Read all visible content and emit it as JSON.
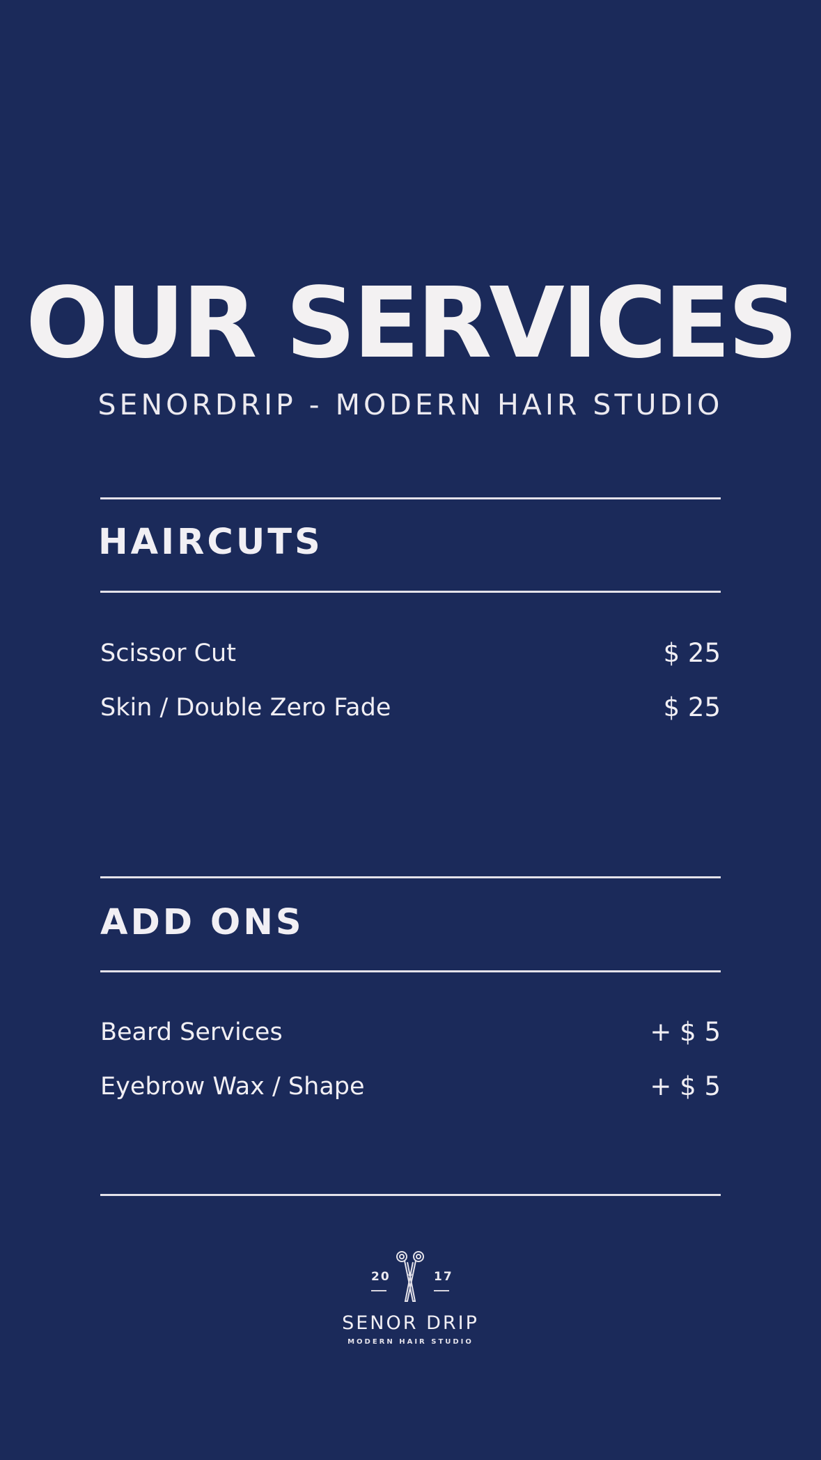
{
  "header": {
    "title": "OUR SERVICES",
    "subtitle": "SENORDRIP - MODERN HAIR STUDIO"
  },
  "sections": [
    {
      "heading": "HAIRCUTS",
      "items": [
        {
          "name": "Scissor Cut",
          "price": "$ 25"
        },
        {
          "name": "Skin / Double Zero  Fade",
          "price": "$ 25"
        }
      ]
    },
    {
      "heading": "ADD ONS",
      "items": [
        {
          "name": "Beard Services",
          "price": "+ $ 5"
        },
        {
          "name": "Eyebrow Wax / Shape",
          "price": "+ $ 5"
        }
      ]
    }
  ],
  "logo": {
    "icon": "scissors-icon",
    "year_left": "20",
    "year_right": "17",
    "name": "SENOR DRIP",
    "tagline": "MODERN HAIR STUDIO"
  },
  "colors": {
    "background": "#1b2a5a",
    "text": "#f1eff0"
  }
}
